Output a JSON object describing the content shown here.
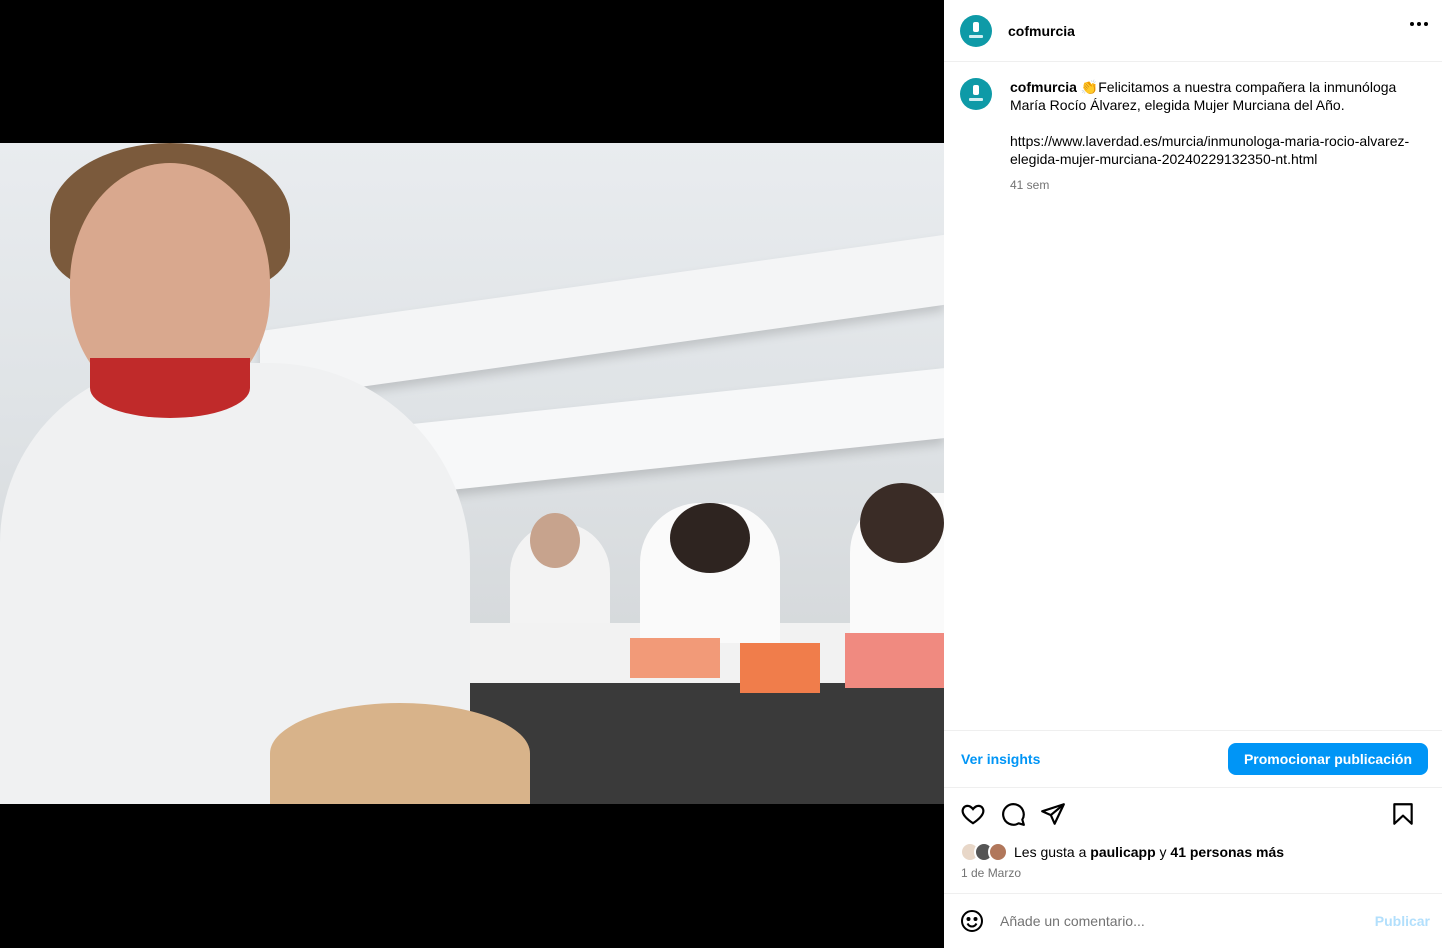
{
  "post": {
    "username": "cofmurcia",
    "caption_emoji": "👏",
    "caption": "Felicitamos a nuestra compañera la inmunóloga María Rocío Álvarez, elegida Mujer Murciana del Año.",
    "link": "https://www.laverdad.es/murcia/inmunologa-maria-rocio-alvarez-elegida-mujer-murciana-20240229132350-nt.html",
    "time_ago": "41 sem"
  },
  "insights": {
    "ver_insights": "Ver insights",
    "promote": "Promocionar publicación"
  },
  "likes": {
    "prefix": "Les gusta a",
    "user": "paulicapp",
    "connector": "y",
    "others": "41 personas más",
    "date": "1 de Marzo"
  },
  "comment": {
    "placeholder": "Añade un comentario...",
    "publish": "Publicar"
  },
  "icons": {
    "like": "heart-icon",
    "comment": "comment-icon",
    "share": "share-icon",
    "save": "bookmark-icon",
    "emoji": "emoji-icon",
    "more": "more-options-icon"
  },
  "colors": {
    "accent": "#0095f6",
    "brand_avatar": "#0e9aa7",
    "publish_disabled": "#b2dffc"
  }
}
